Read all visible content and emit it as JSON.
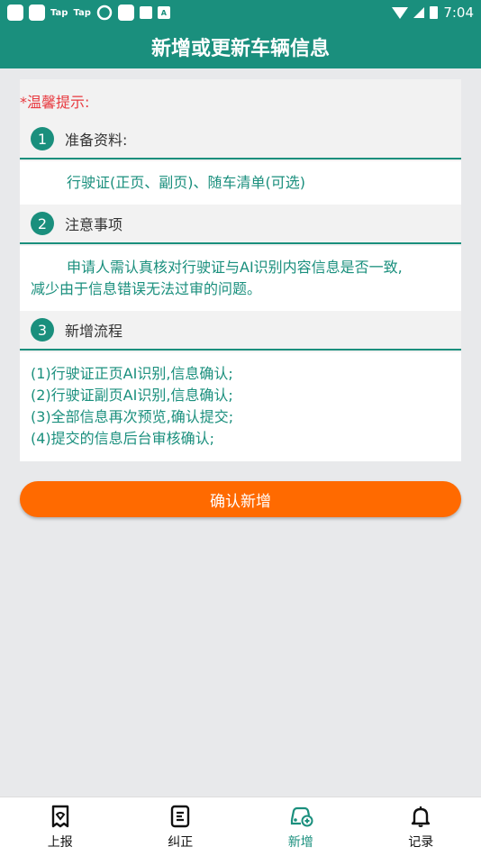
{
  "status_bar": {
    "tap1": "Tap",
    "tap2": "Tap",
    "badge_a": "A",
    "time": "7:04"
  },
  "app_bar": {
    "title": "新增或更新车辆信息"
  },
  "tip_label": "*温馨提示:",
  "sections": [
    {
      "number": "1",
      "title": "准备资料:",
      "lines": [
        "行驶证(正页、副页)、随车清单(可选)"
      ]
    },
    {
      "number": "2",
      "title": "注意事项",
      "lines": [
        "申请人需认真核对行驶证与AI识别内容信息是否一致,",
        "减少由于信息错误无法过审的问题。"
      ]
    },
    {
      "number": "3",
      "title": "新增流程",
      "lines": [
        "(1)行驶证正页AI识别,信息确认;",
        "(2)行驶证副页AI识别,信息确认;",
        "(3)全部信息再次预览,确认提交;",
        "(4)提交的信息后台审核确认;"
      ]
    }
  ],
  "confirm_button": "确认新增",
  "tabs": [
    {
      "label": "上报",
      "icon": "report-icon",
      "active": false
    },
    {
      "label": "纠正",
      "icon": "correct-icon",
      "active": false
    },
    {
      "label": "新增",
      "icon": "vehicle-add-icon",
      "active": true
    },
    {
      "label": "记录",
      "icon": "bell-icon",
      "active": false
    }
  ],
  "colors": {
    "primary": "#1a8f7d",
    "accent": "#ff6a00",
    "tip": "#e8393f"
  }
}
